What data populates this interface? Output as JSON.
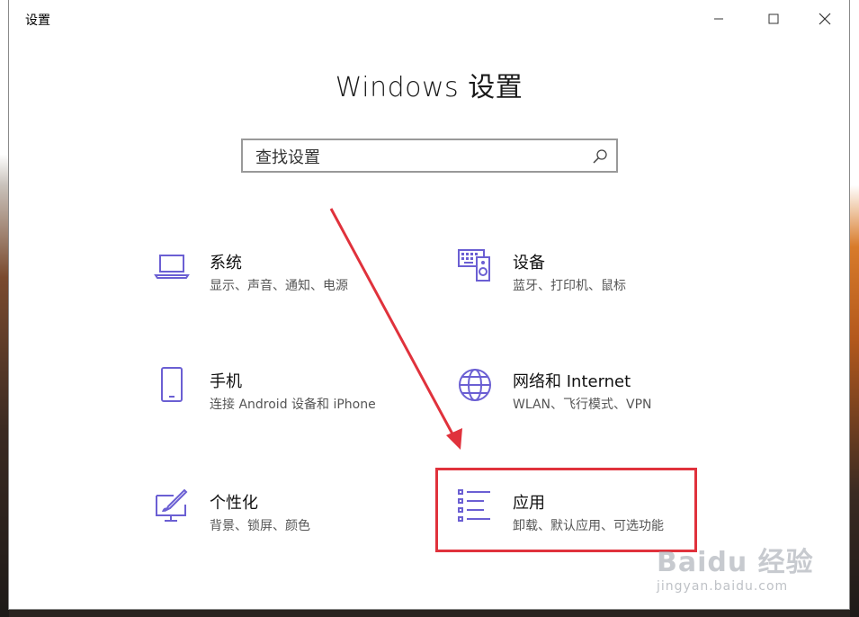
{
  "window": {
    "title": "设置",
    "heading": "Windows 设置"
  },
  "search": {
    "placeholder": "查找设置"
  },
  "tiles": [
    {
      "name": "系统",
      "desc": "显示、声音、通知、电源",
      "icon": "laptop-icon"
    },
    {
      "name": "设备",
      "desc": "蓝牙、打印机、鼠标",
      "icon": "devices-icon"
    },
    {
      "name": "手机",
      "desc": "连接 Android 设备和 iPhone",
      "icon": "phone-icon"
    },
    {
      "name": "网络和 Internet",
      "desc": "WLAN、飞行模式、VPN",
      "icon": "globe-icon"
    },
    {
      "name": "个性化",
      "desc": "背景、锁屏、颜色",
      "icon": "personalization-icon"
    },
    {
      "name": "应用",
      "desc": "卸载、默认应用、可选功能",
      "icon": "apps-list-icon"
    }
  ],
  "colors": {
    "accent": "#6b5fd3",
    "annotation_red": "#e0323c"
  },
  "watermark": {
    "logo": "Baidu 经验",
    "url": "jingyan.baidu.com"
  }
}
